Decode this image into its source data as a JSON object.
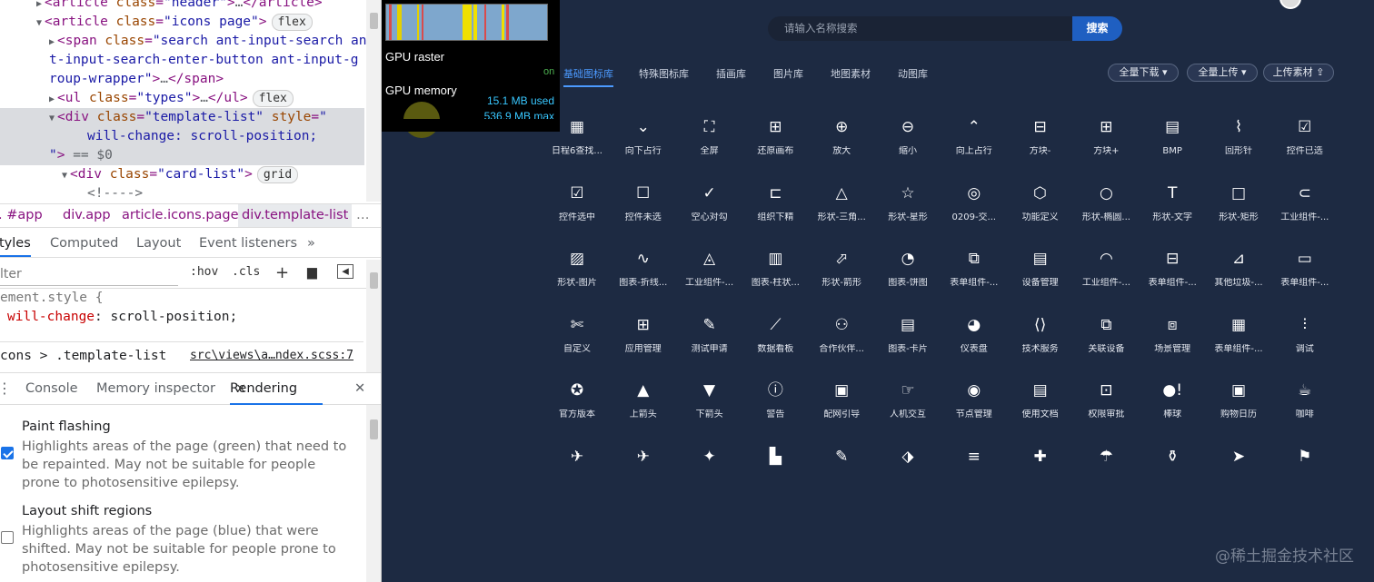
{
  "devtools": {
    "dom_lines": [
      {
        "indent": 3,
        "arrow": "▶",
        "parts": [
          [
            "tag",
            "<article "
          ],
          [
            "attr",
            "class"
          ],
          [
            "tag",
            "="
          ],
          [
            "val",
            "\"header\""
          ],
          [
            "tag",
            ">"
          ],
          [
            "grey",
            "…"
          ],
          [
            "tag",
            "</article>"
          ]
        ]
      },
      {
        "indent": 3,
        "arrow": "▼",
        "parts": [
          [
            "tag",
            "<article "
          ],
          [
            "attr",
            "class"
          ],
          [
            "tag",
            "="
          ],
          [
            "val",
            "\"icons page\""
          ],
          [
            "tag",
            ">"
          ]
        ],
        "pill": "flex"
      },
      {
        "indent": 4,
        "arrow": "▶",
        "parts": [
          [
            "tag",
            "<span "
          ],
          [
            "attr",
            "class"
          ],
          [
            "tag",
            "="
          ],
          [
            "val",
            "\"search ant-input-search an"
          ]
        ]
      },
      {
        "indent": 4,
        "arrow": "",
        "parts": [
          [
            "val",
            "t-input-search-enter-button ant-input-g"
          ]
        ]
      },
      {
        "indent": 4,
        "arrow": "",
        "parts": [
          [
            "val",
            "roup-wrapper\""
          ],
          [
            "tag",
            ">"
          ],
          [
            "grey",
            "…"
          ],
          [
            "tag",
            "</span>"
          ]
        ]
      },
      {
        "indent": 4,
        "arrow": "▶",
        "parts": [
          [
            "tag",
            "<ul "
          ],
          [
            "attr",
            "class"
          ],
          [
            "tag",
            "="
          ],
          [
            "val",
            "\"types\""
          ],
          [
            "tag",
            ">"
          ],
          [
            "grey",
            "…"
          ],
          [
            "tag",
            "</ul>"
          ]
        ],
        "pill": "flex"
      },
      {
        "indent": 4,
        "arrow": "▼",
        "parts": [
          [
            "tag",
            "<div "
          ],
          [
            "attr",
            "class"
          ],
          [
            "tag",
            "="
          ],
          [
            "val",
            "\"template-list\""
          ],
          [
            "tag",
            " "
          ],
          [
            "attr",
            "style"
          ],
          [
            "tag",
            "="
          ],
          [
            "val",
            "\""
          ]
        ]
      },
      {
        "indent": 7,
        "arrow": "",
        "parts": [
          [
            "val",
            "will-change: scroll-position;"
          ]
        ]
      },
      {
        "indent": 4,
        "arrow": "",
        "parts": [
          [
            "val",
            "\""
          ],
          [
            "tag",
            ">"
          ],
          [
            "grey",
            " == $0"
          ]
        ]
      },
      {
        "indent": 5,
        "arrow": "▼",
        "parts": [
          [
            "tag",
            "<div "
          ],
          [
            "attr",
            "class"
          ],
          [
            "tag",
            "="
          ],
          [
            "val",
            "\"card-list\""
          ],
          [
            "tag",
            ">"
          ]
        ],
        "pill": "grid"
      },
      {
        "indent": 7,
        "arrow": "",
        "parts": [
          [
            "grey",
            "<!---->"
          ]
        ]
      }
    ],
    "breadcrumbs": [
      ". #app",
      "div.app",
      "article.icons.page",
      "div.template-list",
      "…"
    ],
    "style_tabs": [
      "tyles",
      "Computed",
      "Layout",
      "Event listeners",
      "»"
    ],
    "filter_placeholder": "lter",
    "hov": ":hov",
    "cls": ".cls",
    "plus": "+",
    "element_style_selector": "ement.style {",
    "element_style_prop": "will-change",
    "element_style_value": "scroll-position;",
    "rule_selector": "cons > .template-list",
    "rule_source": "src\\views\\a…ndex.scss:7",
    "drawer_tabs": [
      "Console",
      "Memory inspector",
      "Rendering"
    ],
    "drawer_close_tab": "×",
    "drawer_close": "✕",
    "paint_flashing_title": "Paint flashing",
    "paint_flashing_desc": "Highlights areas of the page (green) that need to be repainted. May not be suitable for people prone to photosensitive epilepsy.",
    "paint_flashing_checked": true,
    "layout_shift_title": "Layout shift regions",
    "layout_shift_desc": "Highlights areas of the page (blue) that were shifted. May not be suitable for people prone to photosensitive epilepsy.",
    "layout_shift_checked": false
  },
  "hud": {
    "gpu_raster_label": "GPU raster",
    "gpu_raster_state": "on",
    "gpu_memory_label": "GPU memory",
    "gpu_memory_used": "15.1 MB used",
    "gpu_memory_max": "536.9 MB max"
  },
  "app": {
    "search_placeholder": "请输入名称搜索",
    "search_button": "搜索",
    "tabs": [
      "基础图标库",
      "特殊图标库",
      "插画库",
      "图片库",
      "地图素材",
      "动图库"
    ],
    "active_tab": 0,
    "download_all": "全量下载",
    "upload_all": "全量上传",
    "upload_material": "上传素材",
    "watermark": "@稀土掘金技术社区",
    "icons": [
      {
        "name": "calendar-icon",
        "glyph": "▦",
        "label": "日程6查找..."
      },
      {
        "name": "chevrons-down-icon",
        "glyph": "⌄",
        "label": "向下占行"
      },
      {
        "name": "fullscreen-icon",
        "glyph": "⛶",
        "label": "全屏"
      },
      {
        "name": "restore-canvas-icon",
        "glyph": "⊞",
        "label": "还原画布"
      },
      {
        "name": "zoom-in-icon",
        "glyph": "⊕",
        "label": "放大"
      },
      {
        "name": "zoom-out-icon",
        "glyph": "⊖",
        "label": "缩小"
      },
      {
        "name": "chevrons-up-icon",
        "glyph": "⌃",
        "label": "向上占行"
      },
      {
        "name": "square-minus-icon",
        "glyph": "⊟",
        "label": "方块-"
      },
      {
        "name": "square-plus-icon",
        "glyph": "⊞",
        "label": "方块+"
      },
      {
        "name": "bmp-file-icon",
        "glyph": "▤",
        "label": "BMP"
      },
      {
        "name": "paperclip-icon",
        "glyph": "⌇",
        "label": "回形针"
      },
      {
        "name": "checkbox-checked-icon",
        "glyph": "☑",
        "label": "控件已选"
      },
      {
        "name": "checkbox-filled-icon",
        "glyph": "☑",
        "label": "控件选中"
      },
      {
        "name": "checkbox-empty-icon",
        "glyph": "☐",
        "label": "控件未选"
      },
      {
        "name": "circle-check-icon",
        "glyph": "✓",
        "label": "空心对勾"
      },
      {
        "name": "org-chart-icon",
        "glyph": "⊏",
        "label": "组织下精"
      },
      {
        "name": "triangle-icon",
        "glyph": "△",
        "label": "形状-三角..."
      },
      {
        "name": "star-icon",
        "glyph": "☆",
        "label": "形状-星形"
      },
      {
        "name": "lightbulb-icon",
        "glyph": "◎",
        "label": "0209-交..."
      },
      {
        "name": "cube-icon",
        "glyph": "⬡",
        "label": "功能定义"
      },
      {
        "name": "circle-icon",
        "glyph": "○",
        "label": "形状-椭圆..."
      },
      {
        "name": "text-icon",
        "glyph": "T",
        "label": "形状-文字"
      },
      {
        "name": "rectangle-icon",
        "glyph": "□",
        "label": "形状-矩形"
      },
      {
        "name": "toggle-icon",
        "glyph": "⊂",
        "label": "工业组件-..."
      },
      {
        "name": "image-icon",
        "glyph": "▨",
        "label": "形状-图片"
      },
      {
        "name": "line-chart-icon",
        "glyph": "∿",
        "label": "图表-折线..."
      },
      {
        "name": "alarm-bell-icon",
        "glyph": "◬",
        "label": "工业组件-..."
      },
      {
        "name": "bar-chart-icon",
        "glyph": "▥",
        "label": "图表-柱状..."
      },
      {
        "name": "arrow-icon",
        "glyph": "⬀",
        "label": "形状-箭形"
      },
      {
        "name": "pie-chart-icon",
        "glyph": "◔",
        "label": "图表-饼图"
      },
      {
        "name": "form-search-icon",
        "glyph": "⧉",
        "label": "表单组件-..."
      },
      {
        "name": "device-manage-icon",
        "glyph": "▤",
        "label": "设备管理"
      },
      {
        "name": "gauge-icon",
        "glyph": "◠",
        "label": "工业组件-..."
      },
      {
        "name": "form-box-icon",
        "glyph": "⊟",
        "label": "表单组件-..."
      },
      {
        "name": "trash-cart-icon",
        "glyph": "⊿",
        "label": "其他垃圾-..."
      },
      {
        "name": "form-input-icon",
        "glyph": "▭",
        "label": "表单组件-..."
      },
      {
        "name": "tools-icon",
        "glyph": "✄",
        "label": "自定义"
      },
      {
        "name": "apps-icon",
        "glyph": "⊞",
        "label": "应用管理"
      },
      {
        "name": "test-apply-icon",
        "glyph": "✎",
        "label": "测试申请"
      },
      {
        "name": "dashboard-chart-icon",
        "glyph": "⟋",
        "label": "数据看板"
      },
      {
        "name": "partner-icon",
        "glyph": "⚇",
        "label": "合作伙伴..."
      },
      {
        "name": "card-chart-icon",
        "glyph": "▤",
        "label": "图表-卡片"
      },
      {
        "name": "meter-icon",
        "glyph": "◕",
        "label": "仪表盘"
      },
      {
        "name": "tech-service-icon",
        "glyph": "⟨⟩",
        "label": "技术服务"
      },
      {
        "name": "link-device-icon",
        "glyph": "⧉",
        "label": "关联设备"
      },
      {
        "name": "scene-manage-icon",
        "glyph": "⧈",
        "label": "场景管理"
      },
      {
        "name": "form-table-icon",
        "glyph": "▦",
        "label": "表单组件-..."
      },
      {
        "name": "sliders-icon",
        "glyph": "⫶",
        "label": "调试"
      },
      {
        "name": "award-icon",
        "glyph": "✪",
        "label": "官方版本"
      },
      {
        "name": "arrow-up-icon",
        "glyph": "▲",
        "label": "上箭头"
      },
      {
        "name": "arrow-down-icon",
        "glyph": "▼",
        "label": "下箭头"
      },
      {
        "name": "warning-icon",
        "glyph": "ⓘ",
        "label": "警告"
      },
      {
        "name": "guide-icon",
        "glyph": "▣",
        "label": "配网引导"
      },
      {
        "name": "interaction-icon",
        "glyph": "☞",
        "label": "人机交互"
      },
      {
        "name": "node-manage-icon",
        "glyph": "◉",
        "label": "节点管理"
      },
      {
        "name": "document-icon",
        "glyph": "▤",
        "label": "使用文档"
      },
      {
        "name": "permission-icon",
        "glyph": "⊡",
        "label": "权限审批"
      },
      {
        "name": "baseball-icon",
        "glyph": "●!",
        "label": "棒球"
      },
      {
        "name": "shopping-calendar-icon",
        "glyph": "▣",
        "label": "购物日历"
      },
      {
        "name": "coffee-icon",
        "glyph": "☕",
        "label": "咖啡"
      },
      {
        "name": "rocket-icon",
        "glyph": "✈",
        "label": ""
      },
      {
        "name": "airplane-icon",
        "glyph": "✈",
        "label": ""
      },
      {
        "name": "fish-icon",
        "glyph": "✦",
        "label": ""
      },
      {
        "name": "bar-stats-icon",
        "glyph": "▙",
        "label": ""
      },
      {
        "name": "edit-icon",
        "glyph": "✎",
        "label": ""
      },
      {
        "name": "tag-icon",
        "glyph": "⬗",
        "label": ""
      },
      {
        "name": "menu-icon",
        "glyph": "≡",
        "label": ""
      },
      {
        "name": "medicine-icon",
        "glyph": "✚",
        "label": ""
      },
      {
        "name": "umbrella-icon",
        "glyph": "☂",
        "label": ""
      },
      {
        "name": "bottle-icon",
        "glyph": "⚱",
        "label": ""
      },
      {
        "name": "send-icon",
        "glyph": "➤",
        "label": ""
      },
      {
        "name": "flag-icon",
        "glyph": "⚑",
        "label": ""
      }
    ]
  }
}
